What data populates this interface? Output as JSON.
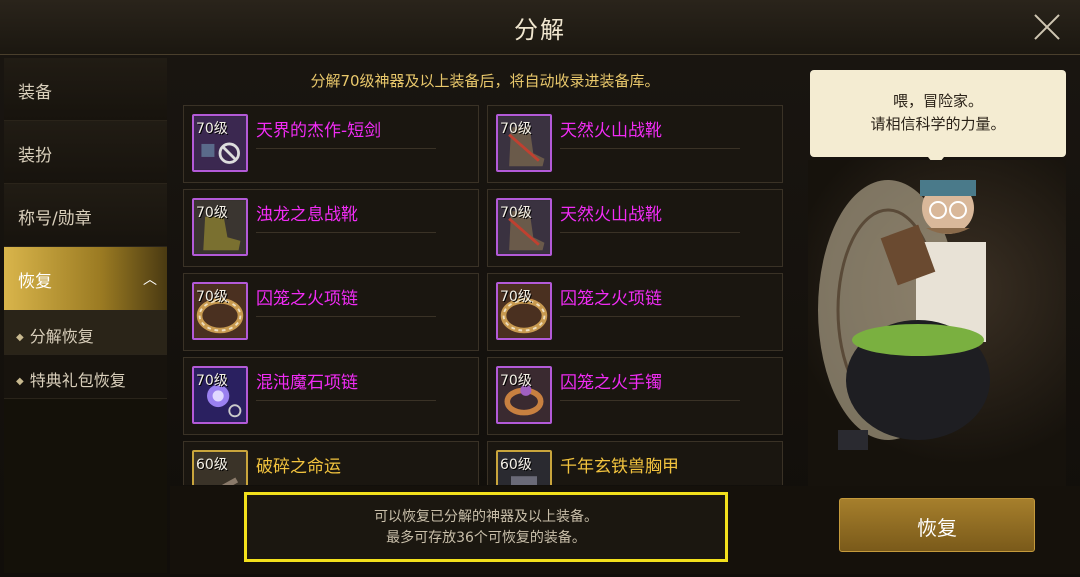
{
  "window": {
    "title": "分解"
  },
  "sidebar": {
    "items": [
      {
        "label": "装备"
      },
      {
        "label": "装扮"
      },
      {
        "label": "称号/勋章"
      },
      {
        "label": "恢复"
      }
    ],
    "sub_items": [
      {
        "label": "分解恢复"
      },
      {
        "label": "特典礼包恢复"
      }
    ]
  },
  "notice": "分解70级神器及以上装备后，将自动收录进装备库。",
  "items": [
    {
      "level": "70级",
      "name": "天界的杰作-短剑",
      "rarity": "epic"
    },
    {
      "level": "70级",
      "name": "天然火山战靴",
      "rarity": "epic"
    },
    {
      "level": "70级",
      "name": "浊龙之息战靴",
      "rarity": "epic"
    },
    {
      "level": "70级",
      "name": "天然火山战靴",
      "rarity": "epic"
    },
    {
      "level": "70级",
      "name": "囚笼之火项链",
      "rarity": "epic"
    },
    {
      "level": "70级",
      "name": "囚笼之火项链",
      "rarity": "epic"
    },
    {
      "level": "70级",
      "name": "混沌魔石项链",
      "rarity": "epic"
    },
    {
      "level": "70级",
      "name": "囚笼之火手镯",
      "rarity": "epic"
    },
    {
      "level": "60级",
      "name": "破碎之命运",
      "rarity": "legendary"
    },
    {
      "level": "60级",
      "name": "千年玄铁兽胸甲",
      "rarity": "legendary"
    }
  ],
  "npc": {
    "speech_line1": "喂，冒险家。",
    "speech_line2": "请相信科学的力量。"
  },
  "footer": {
    "info_line1": "可以恢复已分解的神器及以上装备。",
    "info_line2": "最多可存放36个可恢复的装备。",
    "restore_label": "恢复"
  },
  "colors": {
    "epic_name": "#f02cf4",
    "legendary_name": "#f2c33e",
    "highlight_border": "#f2e01c"
  }
}
